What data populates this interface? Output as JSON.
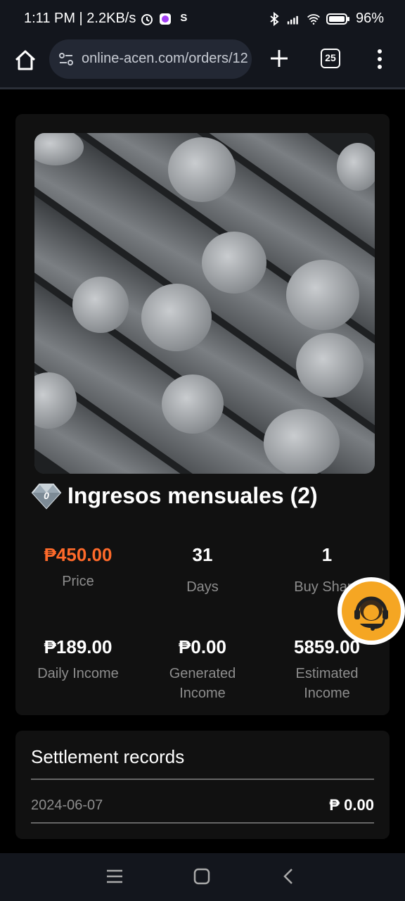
{
  "status_bar": {
    "time_speed": "1:11 PM | 2.2KB/s",
    "s_label": "S",
    "battery": "96%"
  },
  "browser": {
    "url": "online-acen.com/orders/12",
    "tab_count": "25"
  },
  "product": {
    "title": "Ingresos mensuales (2)",
    "stats": [
      {
        "value": "₱450.00",
        "label": "Price"
      },
      {
        "value": "31",
        "label": "Days"
      },
      {
        "value": "1",
        "label": "Buy Share"
      },
      {
        "value": "₱189.00",
        "label": "Daily Income"
      },
      {
        "value": "₱0.00",
        "label": "Generated Income"
      },
      {
        "value": "5859.00",
        "label": "Estimated Income"
      }
    ],
    "accent_color": "#ff6a2a"
  },
  "records": {
    "title": "Settlement records",
    "rows": [
      {
        "date": "2024-06-07",
        "amount": "₱ 0.00"
      }
    ]
  }
}
